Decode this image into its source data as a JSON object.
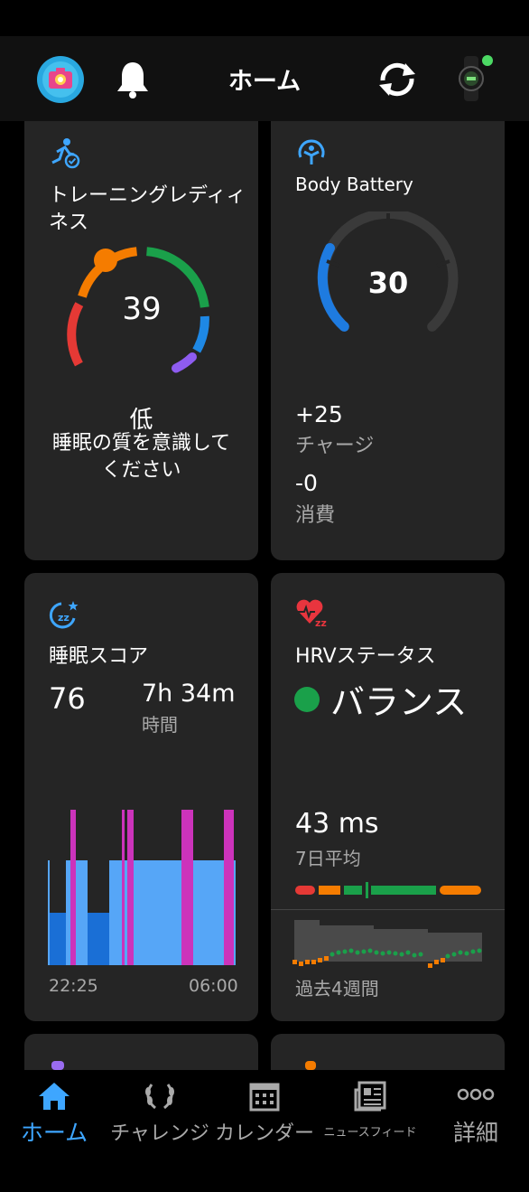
{
  "header": {
    "title": "ホーム"
  },
  "cards": {
    "training_readiness": {
      "title_line1": "トレーニングレディィ",
      "title_line2": "ネス",
      "score": "39",
      "level": "低",
      "message_line1": "睡眠の質を意識して",
      "message_line2": "ください",
      "colors": [
        "#e53935",
        "#f57c00",
        "#1aa04a",
        "#1e88e5",
        "#8e5cf0"
      ]
    },
    "body_battery": {
      "title": "Body Battery",
      "value": "30",
      "charge_value": "+25",
      "charge_label": "チャージ",
      "drain_value": "-0",
      "drain_label": "消費",
      "level_fraction": 0.3
    },
    "sleep_score": {
      "title": "睡眠スコア",
      "score": "76",
      "duration": "7h 34m",
      "duration_label": "時間",
      "start_time": "22:25",
      "end_time": "06:00"
    },
    "hrv_status": {
      "title": "HRVステータス",
      "status": "バランス",
      "status_color": "#1aa04a",
      "average_value": "43 ms",
      "average_label": "7日平均",
      "history_label": "過去4週間"
    }
  },
  "bottom_nav": {
    "items": [
      {
        "label": "ホーム",
        "icon": "home-icon",
        "active": true
      },
      {
        "label": "チャレンジ",
        "icon": "laurel-icon",
        "active": false
      },
      {
        "label": "カレンダー",
        "icon": "calendar-icon",
        "active": false
      },
      {
        "label": "ニュースフィード",
        "icon": "newsfeed-icon",
        "active": false
      },
      {
        "label": "詳細",
        "icon": "more-icon",
        "active": false
      }
    ]
  }
}
